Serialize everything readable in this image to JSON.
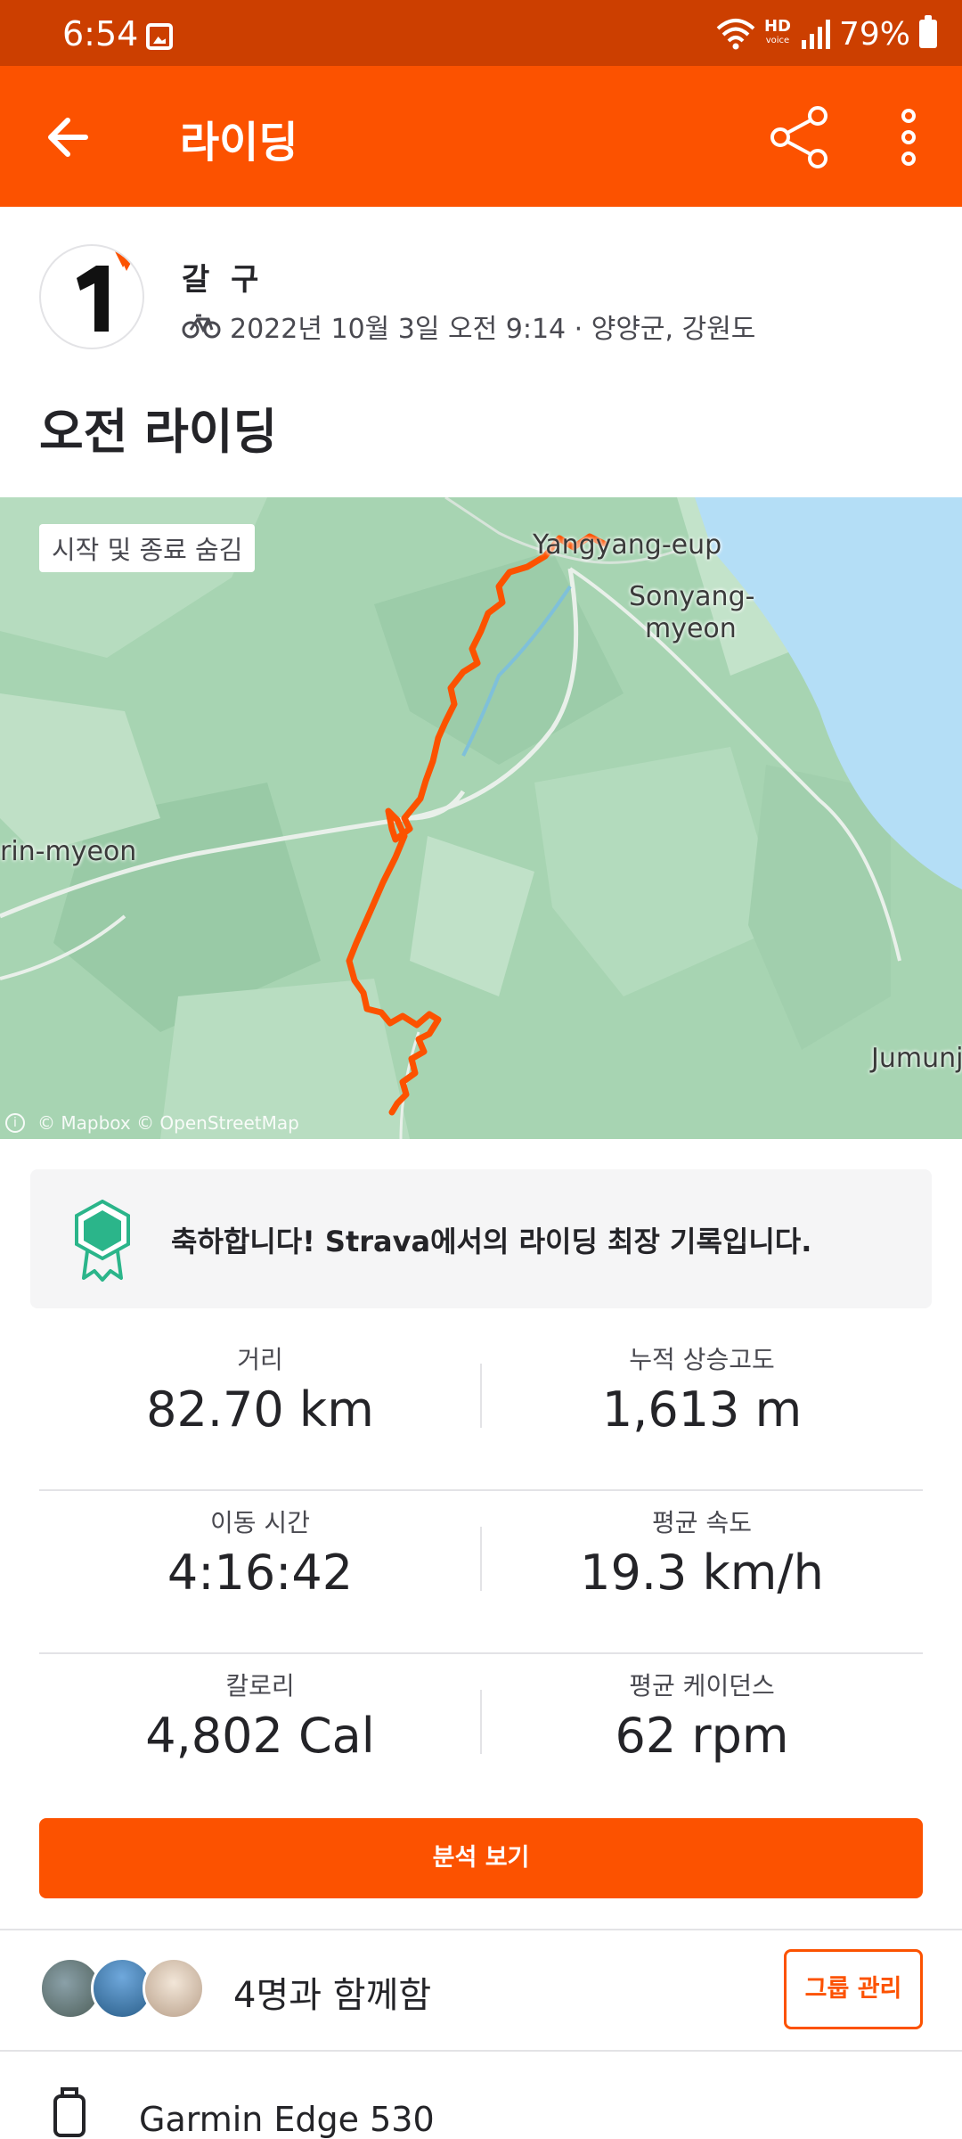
{
  "status_bar": {
    "time": "6:54",
    "hd_label": "HD",
    "voice_label": "voice",
    "battery": "79%",
    "icons": [
      "gallery-icon",
      "wifi-icon",
      "signal-icon",
      "battery-icon"
    ]
  },
  "app_bar": {
    "title": "라이딩",
    "icons": [
      "back-arrow-icon",
      "share-icon",
      "more-vertical-icon"
    ]
  },
  "athlete": {
    "name": "갈 구",
    "meta": "2022년 10월 3일 오전 9:14 · 양양군, 강원도",
    "activity_icon": "bike-icon"
  },
  "activity": {
    "title": "오전 라이딩"
  },
  "map": {
    "toggle_label": "시작 및 종료 숨김",
    "places": {
      "yangyang": "Yangyang-eup",
      "sonyang_1": "Sonyang-",
      "sonyang_2": "myeon",
      "left_town": "rin-myeon",
      "jumunjin": "Jumunj"
    },
    "attribution": "© Mapbox © OpenStreetMap",
    "route_color": "#fc5200",
    "sea_color": "#b4def6"
  },
  "achievement": {
    "text": "축하합니다! Strava에서의 라이딩 최장 기록입니다.",
    "badge_color": "#2bb58a"
  },
  "stats": [
    [
      {
        "label": "거리",
        "value": "82.70 km"
      },
      {
        "label": "누적 상승고도",
        "value": "1,613 m"
      }
    ],
    [
      {
        "label": "이동 시간",
        "value": "4:16:42"
      },
      {
        "label": "평균 속도",
        "value": "19.3 km/h"
      }
    ],
    [
      {
        "label": "칼로리",
        "value": "4,802 Cal"
      },
      {
        "label": "평균 케이던스",
        "value": "62 rpm"
      }
    ]
  ],
  "analysis_button": "분석 보기",
  "group": {
    "with_text": "4명과 함께함",
    "manage_button": "그룹 관리"
  },
  "device": {
    "name": "Garmin Edge 530",
    "icon": "watch-icon"
  },
  "colors": {
    "brand": "#fc5200",
    "status_bar": "#cc3f00",
    "text": "#242428"
  }
}
